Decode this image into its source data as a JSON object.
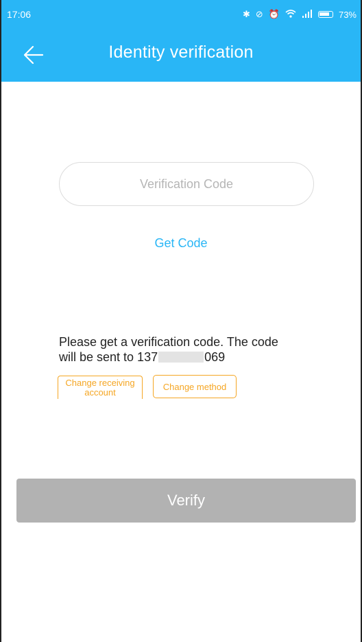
{
  "status_bar": {
    "time": "17:06",
    "icons": [
      "bluetooth-icon",
      "do-not-disturb-icon",
      "alarm-icon",
      "wifi-icon",
      "signal-icon",
      "battery-icon"
    ],
    "battery_percent": "73%"
  },
  "header": {
    "title": "Identity verification",
    "back_icon": "back-arrow-icon"
  },
  "form": {
    "code_placeholder": "Verification Code",
    "code_value": "",
    "get_code_label": "Get Code"
  },
  "info": {
    "line1": "Please get a verification code. The code",
    "line2_prefix": "will be sent to 137",
    "line2_suffix": "069"
  },
  "buttons": {
    "change_account": "Change receiving account",
    "change_method": "Change method",
    "verify": "Verify"
  },
  "colors": {
    "primary": "#29b6f6",
    "accent": "#f5a623",
    "disabled": "#b2b2b2"
  }
}
